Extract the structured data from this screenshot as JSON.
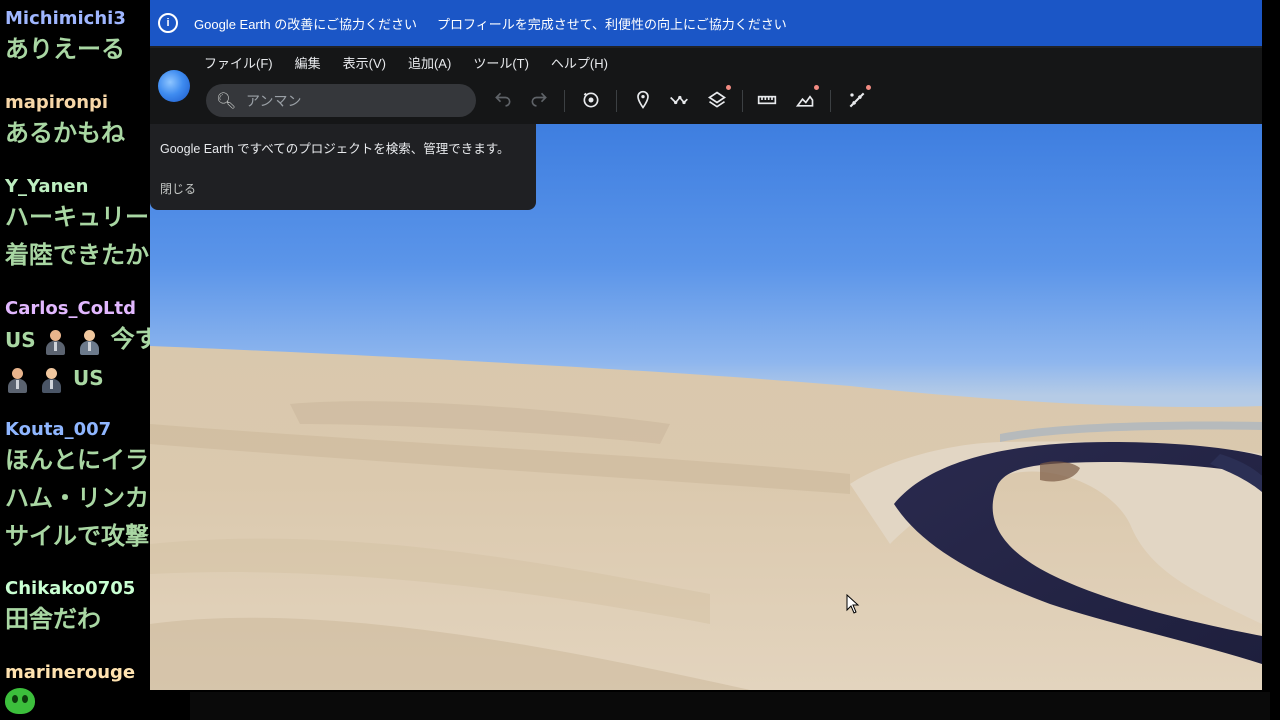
{
  "chat": {
    "messages": [
      {
        "user": "Michimichi3",
        "user_color": "#9fb6ff",
        "text": "ありえーる"
      },
      {
        "user": "mapironpi",
        "user_color": "#f7d7a8",
        "text": "あるかもね"
      },
      {
        "user": "Y_Yanen",
        "user_color": "#bdeec0",
        "text": "ハーキュリー",
        "text2": "着陸できたか"
      },
      {
        "user": "Carlos_CoLtd",
        "user_color": "#e2b8ff",
        "text": "US",
        "text_after": "今す",
        "text2": "US"
      },
      {
        "user": "Kouta_007",
        "user_color": "#8fb6ff",
        "text": "ほんとにイラ",
        "text2": "ハム・リンカ",
        "text3": "サイルで攻撃"
      },
      {
        "user": "Chikako0705",
        "user_color": "#c9ffd2",
        "text": "田舎だわ"
      },
      {
        "user": "marinerouge",
        "user_color": "#ffe3b0",
        "text": ""
      }
    ]
  },
  "info_bar": {
    "message1": "Google Earth の改善にご協力ください",
    "message2": "プロフィールを完成させて、利便性の向上にご協力ください"
  },
  "menu": {
    "items": [
      "ファイル(F)",
      "編集",
      "表示(V)",
      "追加(A)",
      "ツール(T)",
      "ヘルプ(H)"
    ]
  },
  "search": {
    "placeholder": "アンマン"
  },
  "toolbar": {
    "icons": [
      "undo-icon",
      "redo-icon",
      "voyager-icon",
      "add-placemark-icon",
      "add-path-icon",
      "map-style-icon",
      "measure-icon",
      "projects-icon",
      "settings-icon"
    ]
  },
  "tooltip": {
    "text": "Google Earth ですべてのプロジェクトを検索、管理できます。",
    "close_label": "閉じる"
  },
  "colors": {
    "accent": "#1b56c6",
    "chat_text": "#a9d7a3",
    "toolbar_bg": "#151617"
  }
}
